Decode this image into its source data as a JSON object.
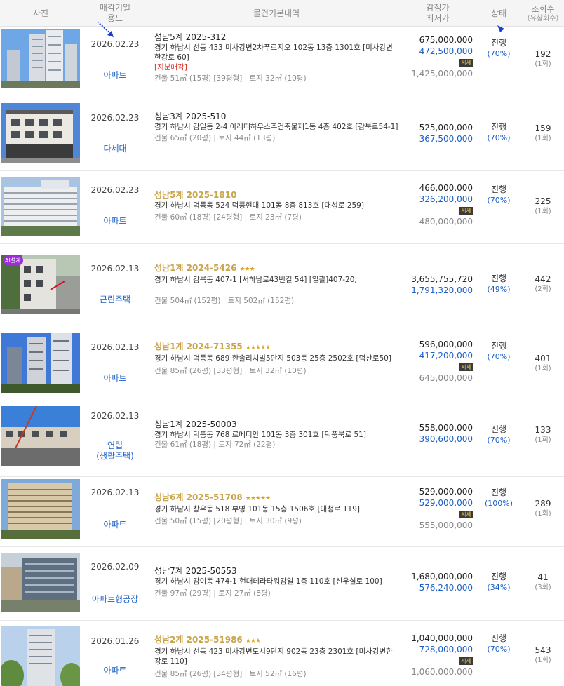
{
  "header": {
    "photo": "사진",
    "date_line1": "매각기일",
    "date_line2": "용도",
    "details": "물건기본내역",
    "price_line1": "감정가",
    "price_line2": "최저가",
    "status": "상태",
    "views_line1": "조회수",
    "views_line2": "(유찰회수)"
  },
  "sise_label": "시세",
  "ai_badge": "AI설계",
  "rows": [
    {
      "date": "2026.02.23",
      "usage": "아파트",
      "usage2": "",
      "case": "성남5계 2025-312",
      "stars": "",
      "addr": "경기 하남시 선동 433 미사강변2차푸르지오 102동 13층 1301호 [미사강변한강로 60]",
      "tag": "[지분매각]",
      "area": "건물 51㎡ (15평) [39평형]  |  토지 32㎡ (10평)",
      "appraisal": "675,000,000",
      "minimum": "472,500,000",
      "market": "1,425,000,000",
      "status": "진행",
      "pct": "(70%)",
      "views": "192",
      "fails": "(1회)"
    },
    {
      "date": "2026.02.23",
      "usage": "다세대",
      "usage2": "",
      "case": "성남3계 2025-510",
      "stars": "",
      "addr": "경기 하남시 감일동 2-4 아레떼하우스주건축물제1동 4층 402호 [감북로54-1]",
      "tag": "",
      "area": "건물 65㎡ (20평)  |  토지 44㎡ (13평)",
      "appraisal": "525,000,000",
      "minimum": "367,500,000",
      "market": "",
      "status": "진행",
      "pct": "(70%)",
      "views": "159",
      "fails": "(1회)"
    },
    {
      "date": "2026.02.23",
      "usage": "아파트",
      "usage2": "",
      "case": "성남5계 2025-1810",
      "stars": "",
      "addr": "경기 하남시 덕풍동 524 덕풍현대 101동 8층 813호 [대성로 259]",
      "tag": "",
      "area": "건물 60㎡ (18평) [24평형]  |  토지 23㎡ (7평)",
      "appraisal": "466,000,000",
      "minimum": "326,200,000",
      "market": "480,000,000",
      "status": "진행",
      "pct": "(70%)",
      "views": "225",
      "fails": "(1회)"
    },
    {
      "date": "2026.02.13",
      "usage": "근린주택",
      "usage2": "",
      "case": "성남1계 2024-5426",
      "stars": "★★★",
      "addr": "경기 하남시 감북동 407-1 [서하남로43번길 54] [일괄]407-20,",
      "tag": "",
      "area": "건물 504㎡ (152평)  |  토지 502㎡ (152평)",
      "appraisal": "3,655,755,720",
      "minimum": "1,791,320,000",
      "market": "",
      "status": "진행",
      "pct": "(49%)",
      "views": "442",
      "fails": "(2회)"
    },
    {
      "date": "2026.02.13",
      "usage": "아파트",
      "usage2": "",
      "case": "성남1계 2024-71355",
      "stars": "★★★★★",
      "addr": "경기 하남시 덕풍동 689 한솔리치빌5단지 503동 25층 2502호 [덕산로50]",
      "tag": "",
      "area": "건물 85㎡ (26평) [33평형]  |  토지 32㎡ (10평)",
      "appraisal": "596,000,000",
      "minimum": "417,200,000",
      "market": "645,000,000",
      "status": "진행",
      "pct": "(70%)",
      "views": "401",
      "fails": "(1회)"
    },
    {
      "date": "2026.02.13",
      "usage": "연립",
      "usage2": "(생활주택)",
      "case": "성남1계 2025-50003",
      "stars": "",
      "addr": "경기 하남시 덕풍동 768 르메디안 101동 3층 301호 [덕풍북로 51]",
      "tag": "",
      "area": "건물 61㎡ (18평)  |  토지 72㎡ (22평)",
      "appraisal": "558,000,000",
      "minimum": "390,600,000",
      "market": "",
      "status": "진행",
      "pct": "(70%)",
      "views": "133",
      "fails": "(1회)"
    },
    {
      "date": "2026.02.13",
      "usage": "아파트",
      "usage2": "",
      "case": "성남6계 2025-51708",
      "stars": "★★★★★",
      "addr": "경기 하남시 창우동 518 부영 101동 15층 1506호 [대청로 119]",
      "tag": "",
      "area": "건물 50㎡ (15평) [20평형]  |  토지 30㎡ (9평)",
      "appraisal": "529,000,000",
      "minimum": "529,000,000",
      "market": "555,000,000",
      "status": "진행",
      "pct": "(100%)",
      "views": "289",
      "fails": "(1회)"
    },
    {
      "date": "2026.02.09",
      "usage": "아파트형공장",
      "usage2": "",
      "case": "성남7계 2025-50553",
      "stars": "",
      "addr": "경기 하남시 감이동 474-1 현대테라타워감일 1층 110호 [신우실로 100]",
      "tag": "",
      "area": "건물 97㎡ (29평)  |  토지 27㎡ (8평)",
      "appraisal": "1,680,000,000",
      "minimum": "576,240,000",
      "market": "",
      "status": "진행",
      "pct": "(34%)",
      "views": "41",
      "fails": "(3회)"
    },
    {
      "date": "2026.01.26",
      "usage": "아파트",
      "usage2": "",
      "case": "성남2계 2025-51986",
      "stars": "★★★",
      "addr": "경기 하남시 선동 423 미사강변도시9단지 902동 23층 2301호 [미사강변한강로 110]",
      "tag": "",
      "area": "건물 85㎡ (26평) [34평형]  |  토지 52㎡ (16평)",
      "appraisal": "1,040,000,000",
      "minimum": "728,000,000",
      "market": "1,060,000,000",
      "status": "진행",
      "pct": "(70%)",
      "views": "543",
      "fails": "(1회)"
    }
  ],
  "colors": {
    "accent": "#1b5fc7",
    "gold": "#c8a44a",
    "red": "#d8322a"
  }
}
